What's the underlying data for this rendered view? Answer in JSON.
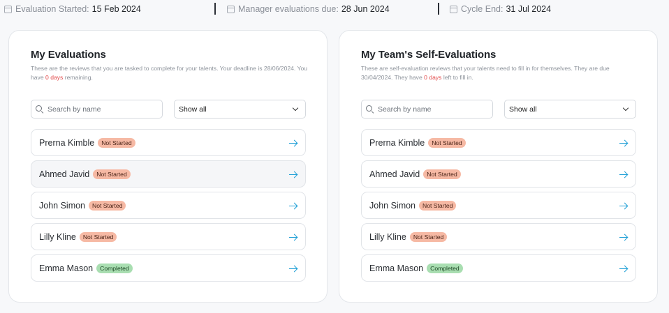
{
  "header": {
    "evaluation_started": {
      "label": "Evaluation Started:",
      "value": "15 Feb 2024"
    },
    "manager_due": {
      "label": "Manager evaluations due:",
      "value": "28 Jun 2024"
    },
    "cycle_end": {
      "label": "Cycle End:",
      "value": "31 Jul 2024"
    }
  },
  "my_evaluations": {
    "title": "My Evaluations",
    "desc_part1": "These are the reviews that you are tasked to complete for your talents. Your deadline is 28/06/2024. You have ",
    "desc_days": "0 days",
    "desc_part2": " remaining.",
    "search_placeholder": "Search by name",
    "filter_value": "Show all",
    "rows": [
      {
        "name": "Prerna Kimble",
        "status": "Not Started"
      },
      {
        "name": "Ahmed Javid",
        "status": "Not Started"
      },
      {
        "name": "John Simon",
        "status": "Not Started"
      },
      {
        "name": "Lilly Kline",
        "status": "Not Started"
      },
      {
        "name": "Emma Mason",
        "status": "Completed"
      }
    ]
  },
  "team_self_evaluations": {
    "title": "My Team's Self-Evaluations",
    "desc_part1": "These are self-evaluation reviews that your talents need to fill in for themselves. They are due 30/04/2024. They have ",
    "desc_days": "0 days",
    "desc_part2": " left to fill in.",
    "search_placeholder": "Search by name",
    "filter_value": "Show all",
    "rows": [
      {
        "name": "Prerna Kimble",
        "status": "Not Started"
      },
      {
        "name": "Ahmed Javid",
        "status": "Not Started"
      },
      {
        "name": "John Simon",
        "status": "Not Started"
      },
      {
        "name": "Lilly Kline",
        "status": "Not Started"
      },
      {
        "name": "Emma Mason",
        "status": "Completed"
      }
    ]
  },
  "colors": {
    "accent_arrow": "#1e9fd6",
    "not_started_badge": "#f6b9a4",
    "completed_badge": "#a9deb1",
    "days_highlight": "#e24b4b"
  },
  "icons": {
    "date": "calendar-icon",
    "search": "search-icon",
    "dropdown": "chevron-down-icon",
    "row_action": "arrow-right-icon"
  }
}
